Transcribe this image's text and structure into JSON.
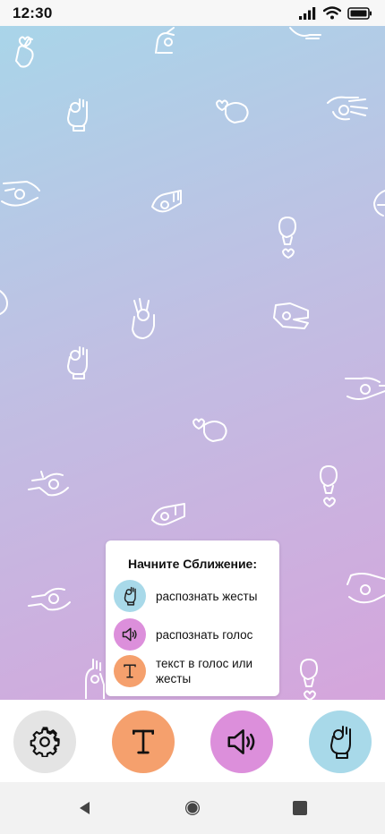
{
  "status_bar": {
    "time": "12:30"
  },
  "card": {
    "title": "Начните Сближение:",
    "options": [
      {
        "label": "распознать жесты",
        "icon": "ok-hand-icon",
        "color": "#a8d9e9"
      },
      {
        "label": "распознать голос",
        "icon": "speaker-icon",
        "color": "#dc8fdb"
      },
      {
        "label": "текст в голос или жесты",
        "icon": "text-t-icon",
        "color": "#f5a06d"
      }
    ]
  },
  "bottom_bar": {
    "buttons": [
      {
        "name": "settings",
        "icon": "gear-icon",
        "color": "#e4e4e4"
      },
      {
        "name": "text",
        "icon": "text-t-icon",
        "color": "#f5a06d"
      },
      {
        "name": "voice",
        "icon": "speaker-icon",
        "color": "#dc8fdb"
      },
      {
        "name": "gestures",
        "icon": "ok-hand-icon",
        "color": "#a8d9e9"
      }
    ]
  },
  "nav_bar": {
    "buttons": [
      "back-icon",
      "home-icon",
      "recents-icon"
    ]
  },
  "background": {
    "gradient": [
      "#a9d5e9",
      "#c0bfe3",
      "#d5a5dc"
    ],
    "pattern": "white outline hand gesture icons"
  }
}
